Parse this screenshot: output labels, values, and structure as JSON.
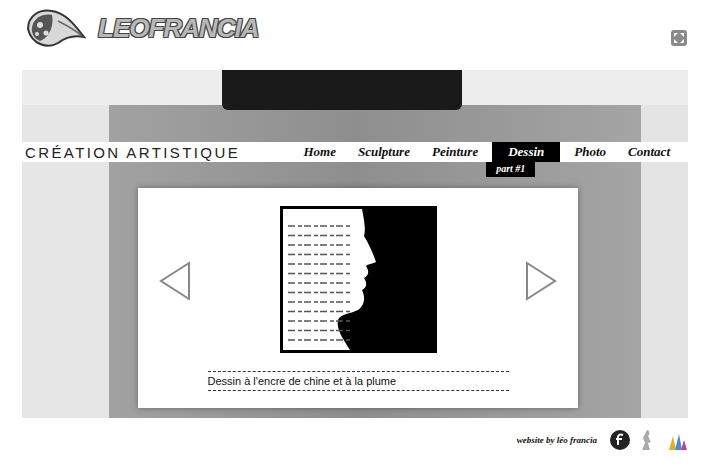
{
  "logo": {
    "text": "LEOFRANCIA"
  },
  "tagline": "CRÉATION ARTISTIQUE",
  "nav": [
    {
      "label": "Home",
      "selected": false
    },
    {
      "label": "Sculpture",
      "selected": false
    },
    {
      "label": "Peinture",
      "selected": false
    },
    {
      "label": "Dessin",
      "selected": true
    },
    {
      "label": "Photo",
      "selected": false
    },
    {
      "label": "Contact",
      "selected": false
    }
  ],
  "submenu": {
    "label": "part #1"
  },
  "gallery": {
    "caption": "Dessin à l'encre de chine et à la plume"
  },
  "footer": {
    "credit": "website by léo francia"
  }
}
